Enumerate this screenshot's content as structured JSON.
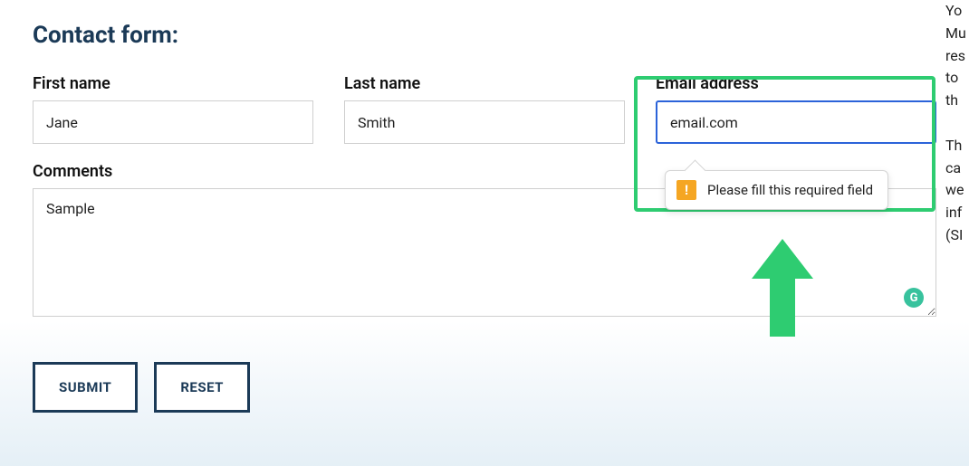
{
  "form": {
    "title": "Contact form:",
    "first_name": {
      "label": "First name",
      "value": "Jane"
    },
    "last_name": {
      "label": "Last name",
      "value": "Smith"
    },
    "email": {
      "label": "Email address",
      "value": "email.com"
    },
    "comments": {
      "label": "Comments",
      "value": "Sample"
    },
    "submit_label": "SUBMIT",
    "reset_label": "RESET"
  },
  "validation": {
    "message": "Please fill this required field",
    "icon_glyph": "!"
  },
  "grammarly": {
    "glyph": "G"
  },
  "side_text": "Yo\nMu\nres\nto\nth\n\nTh\nca\nwe\ninf\n(SI"
}
